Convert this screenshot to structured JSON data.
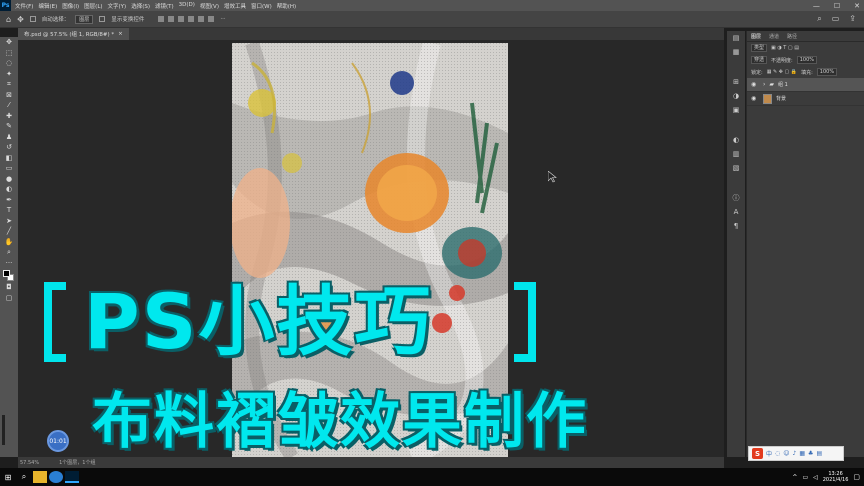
{
  "app": {
    "logo": "Ps",
    "menu": [
      "文件(F)",
      "编辑(E)",
      "图像(I)",
      "图层(L)",
      "文字(Y)",
      "选择(S)",
      "滤镜(T)",
      "3D(D)",
      "视图(V)",
      "增效工具",
      "窗口(W)",
      "帮助(H)"
    ],
    "window_controls": [
      "—",
      "☐",
      "✕"
    ]
  },
  "options_bar": {
    "auto_select_label": "自动选择：",
    "auto_select_value": "图层",
    "show_transform_label": "显示变换控件",
    "more": "···"
  },
  "document": {
    "tab_label": "布.psd @ 57.5% (组 1, RGB/8#) *",
    "tab_close": "×"
  },
  "status": {
    "zoom": "57.54%",
    "info": "1个图层，1个组"
  },
  "panel": {
    "tabs": [
      "图层",
      "通道",
      "路径"
    ],
    "kind_label": "类型",
    "blend_mode": "穿透",
    "opacity_label": "不透明度:",
    "opacity_value": "100%",
    "lock_label": "锁定:",
    "fill_label": "填充:",
    "fill_value": "100%",
    "layers": [
      {
        "name": "组 1",
        "type": "group",
        "selected": true
      },
      {
        "name": "背景",
        "type": "image",
        "selected": false
      }
    ]
  },
  "overlay": {
    "title": "PS小技巧",
    "subtitle": "布料褶皱效果制作",
    "timer": "01:01"
  },
  "taskbar": {
    "clock_time": "13:26",
    "clock_date": "2021/4/16",
    "ime_logo": "S",
    "ime_lang": "中"
  },
  "colors": {
    "accent": "#00e8ee",
    "ps_blue": "#31a8ff",
    "ui_dark": "#535353"
  }
}
